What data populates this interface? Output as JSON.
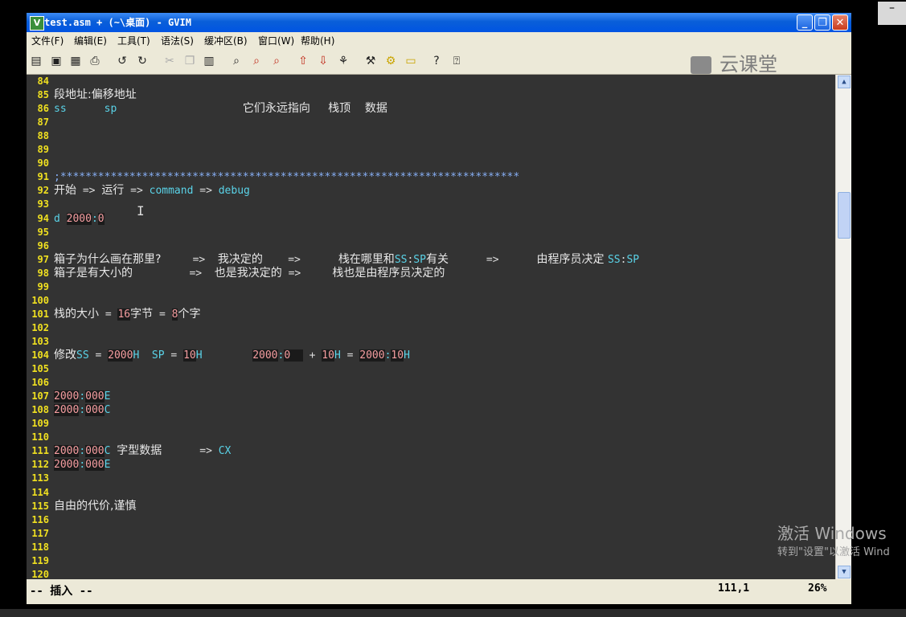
{
  "window": {
    "title": "test.asm + (~\\桌面) - GVIM",
    "controls": {
      "minimize": "_",
      "maximize": "❐",
      "close": "✕"
    }
  },
  "menu": [
    "文件(F)",
    "编辑(E)",
    "工具(T)",
    "语法(S)",
    "缓冲区(B)",
    "窗口(W)",
    "帮助(H)"
  ],
  "brand": "云课堂",
  "lines": [
    {
      "n": "84",
      "parts": []
    },
    {
      "n": "85",
      "parts": [
        {
          "t": "段地址:偏移地址",
          "c": "cj"
        }
      ]
    },
    {
      "n": "86",
      "parts": [
        {
          "t": "ss      sp",
          "c": "kw"
        },
        {
          "t": "                    ",
          "c": "wh"
        },
        {
          "t": "它们永远指向     栈顶    数据",
          "c": "cj"
        }
      ]
    },
    {
      "n": "87",
      "parts": []
    },
    {
      "n": "88",
      "parts": []
    },
    {
      "n": "89",
      "parts": []
    },
    {
      "n": "90",
      "parts": []
    },
    {
      "n": "91",
      "parts": [
        {
          "t": ";*************************************************************************",
          "c": "st"
        }
      ]
    },
    {
      "n": "92",
      "parts": [
        {
          "t": "开始",
          "c": "cj"
        },
        {
          "t": " => ",
          "c": "wh"
        },
        {
          "t": "运行",
          "c": "cj"
        },
        {
          "t": " => ",
          "c": "wh"
        },
        {
          "t": "command",
          "c": "kw"
        },
        {
          "t": " => ",
          "c": "wh"
        },
        {
          "t": "debug",
          "c": "kw"
        }
      ]
    },
    {
      "n": "93",
      "parts": []
    },
    {
      "n": "94",
      "parts": [
        {
          "t": "d ",
          "c": "kw"
        },
        {
          "t": "2000",
          "c": "num"
        },
        {
          "t": ":",
          "c": "kw"
        },
        {
          "t": "0",
          "c": "num"
        }
      ]
    },
    {
      "n": "95",
      "parts": []
    },
    {
      "n": "96",
      "parts": []
    },
    {
      "n": "97",
      "parts": [
        {
          "t": "箱子为什么画在那里?",
          "c": "cj"
        },
        {
          "t": "     =>  ",
          "c": "wh"
        },
        {
          "t": "我决定的",
          "c": "cj"
        },
        {
          "t": "    =>      ",
          "c": "wh"
        },
        {
          "t": "栈在哪里和",
          "c": "cj"
        },
        {
          "t": "SS",
          "c": "kw"
        },
        {
          "t": ":",
          "c": "wh"
        },
        {
          "t": "SP",
          "c": "kw"
        },
        {
          "t": "有关",
          "c": "cj"
        },
        {
          "t": "      =>      ",
          "c": "wh"
        },
        {
          "t": "由程序员决定 ",
          "c": "cj"
        },
        {
          "t": "SS",
          "c": "kw"
        },
        {
          "t": ":",
          "c": "wh"
        },
        {
          "t": "SP",
          "c": "kw"
        }
      ]
    },
    {
      "n": "98",
      "parts": [
        {
          "t": "箱子是有大小的",
          "c": "cj"
        },
        {
          "t": "         =>  ",
          "c": "wh"
        },
        {
          "t": "也是我决定的",
          "c": "cj"
        },
        {
          "t": " =>     ",
          "c": "wh"
        },
        {
          "t": "栈也是由程序员决定的",
          "c": "cj"
        }
      ]
    },
    {
      "n": "99",
      "parts": []
    },
    {
      "n": "100",
      "parts": []
    },
    {
      "n": "101",
      "parts": [
        {
          "t": "栈的大小",
          "c": "cj"
        },
        {
          "t": " = ",
          "c": "wh"
        },
        {
          "t": "16",
          "c": "num"
        },
        {
          "t": "字节",
          "c": "cj"
        },
        {
          "t": " = ",
          "c": "wh"
        },
        {
          "t": "8",
          "c": "num"
        },
        {
          "t": "个字",
          "c": "cj"
        }
      ]
    },
    {
      "n": "102",
      "parts": []
    },
    {
      "n": "103",
      "parts": []
    },
    {
      "n": "104",
      "parts": [
        {
          "t": "修改",
          "c": "cj"
        },
        {
          "t": "SS",
          "c": "kw"
        },
        {
          "t": " = ",
          "c": "wh"
        },
        {
          "t": "2000",
          "c": "num"
        },
        {
          "t": "H",
          "c": "kw"
        },
        {
          "t": "  SP",
          "c": "kw"
        },
        {
          "t": " = ",
          "c": "wh"
        },
        {
          "t": "10",
          "c": "num"
        },
        {
          "t": "H",
          "c": "kw"
        },
        {
          "t": "        ",
          "c": "wh"
        },
        {
          "t": "2000",
          "c": "num"
        },
        {
          "t": ":",
          "c": "kw"
        },
        {
          "t": "0  ",
          "c": "num"
        },
        {
          "t": " + ",
          "c": "wh"
        },
        {
          "t": "10",
          "c": "num"
        },
        {
          "t": "H",
          "c": "kw"
        },
        {
          "t": " = ",
          "c": "wh"
        },
        {
          "t": "2000",
          "c": "num"
        },
        {
          "t": ":",
          "c": "kw"
        },
        {
          "t": "10",
          "c": "num"
        },
        {
          "t": "H",
          "c": "kw"
        }
      ]
    },
    {
      "n": "105",
      "parts": []
    },
    {
      "n": "106",
      "parts": []
    },
    {
      "n": "107",
      "parts": [
        {
          "t": "2000",
          "c": "num"
        },
        {
          "t": ":",
          "c": "kw"
        },
        {
          "t": "000",
          "c": "num"
        },
        {
          "t": "E",
          "c": "kw"
        }
      ]
    },
    {
      "n": "108",
      "parts": [
        {
          "t": "2000",
          "c": "num"
        },
        {
          "t": ":",
          "c": "kw"
        },
        {
          "t": "000",
          "c": "num"
        },
        {
          "t": "C",
          "c": "kw"
        }
      ]
    },
    {
      "n": "109",
      "parts": []
    },
    {
      "n": "110",
      "parts": []
    },
    {
      "n": "111",
      "parts": [
        {
          "t": "2000",
          "c": "num"
        },
        {
          "t": ":",
          "c": "kw"
        },
        {
          "t": "000",
          "c": "num"
        },
        {
          "t": "C ",
          "c": "kw"
        },
        {
          "t": "字型数据",
          "c": "cj"
        },
        {
          "t": "      => ",
          "c": "wh"
        },
        {
          "t": "CX",
          "c": "kw"
        }
      ]
    },
    {
      "n": "112",
      "parts": [
        {
          "t": "2000",
          "c": "num"
        },
        {
          "t": ":",
          "c": "kw"
        },
        {
          "t": "000",
          "c": "num"
        },
        {
          "t": "E",
          "c": "kw"
        }
      ]
    },
    {
      "n": "113",
      "parts": []
    },
    {
      "n": "114",
      "parts": []
    },
    {
      "n": "115",
      "parts": [
        {
          "t": "自由的代价,谨慎",
          "c": "cj"
        }
      ]
    },
    {
      "n": "116",
      "parts": []
    },
    {
      "n": "117",
      "parts": []
    },
    {
      "n": "118",
      "parts": []
    },
    {
      "n": "119",
      "parts": []
    },
    {
      "n": "120",
      "parts": []
    }
  ],
  "status": {
    "mode": "-- 插入 --",
    "position": "111,1",
    "percent": "26%"
  },
  "watermark": {
    "line1": "激活 Windows",
    "line2": "转到\"设置\"以激活 Wind"
  },
  "outer_min_button": "–",
  "icons": [
    "open-icon",
    "save-icon",
    "save-all-icon",
    "print-icon",
    "undo-icon",
    "redo-icon",
    "cut-icon",
    "copy-icon",
    "paste-icon",
    "find-icon",
    "find-next-icon",
    "find-prev-icon",
    "load-session-icon",
    "save-session-icon",
    "run-script-icon",
    "make-icon",
    "shell-icon",
    "tags-icon",
    "help-icon",
    "find-help-icon"
  ]
}
